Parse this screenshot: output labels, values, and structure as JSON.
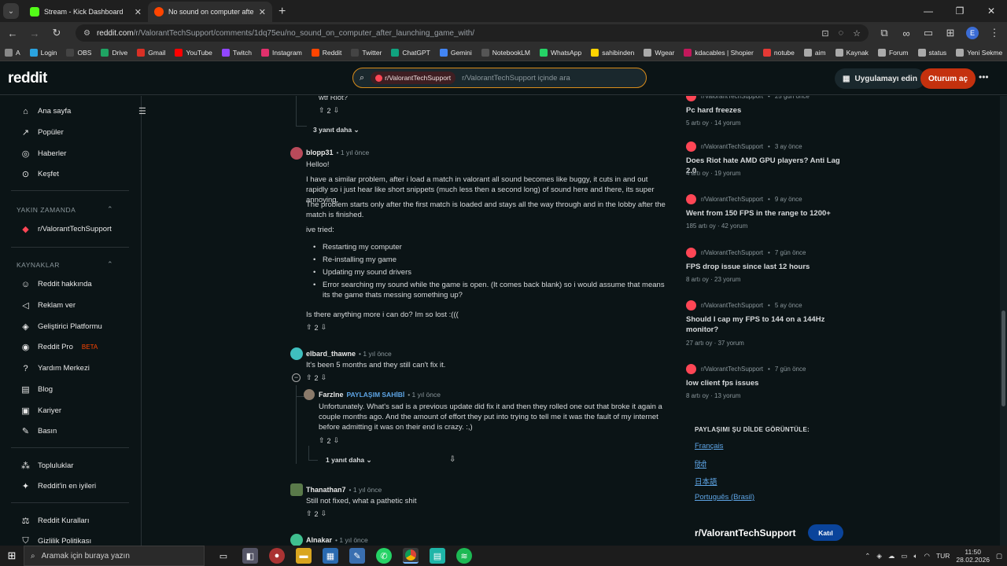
{
  "browser": {
    "tabs": [
      {
        "title": "Stream - Kick Dashboard",
        "active": false,
        "color": "#53fc18"
      },
      {
        "title": "No sound on computer after la",
        "active": true,
        "color": "#ff4500"
      }
    ],
    "url_host": "reddit.com",
    "url_path": "/r/ValorantTechSupport/comments/1dq75eu/no_sound_on_computer_after_launching_game_with/",
    "profile_initial": "E",
    "bookmarks": [
      "A",
      "Login",
      "OBS",
      "Drive",
      "Gmail",
      "YouTube",
      "Twitch",
      "Instagram",
      "Reddit",
      "Twitter",
      "ChatGPT",
      "Gemini",
      "NotebookLM",
      "WhatsApp",
      "sahibinden",
      "Wgear",
      "kdacables | Shopier",
      "notube",
      "aim",
      "Kaynak",
      "Forum",
      "status",
      "Yeni Sekme"
    ]
  },
  "header": {
    "logo": "reddit",
    "search_chip": "r/ValorantTechSupport",
    "search_placeholder": "r/ValorantTechSupport içinde ara",
    "app_button": "Uygulamayı edin",
    "login_button": "Oturum aç"
  },
  "left_nav": {
    "main": [
      "Ana sayfa",
      "Popüler",
      "Haberler",
      "Keşfet"
    ],
    "recent_label": "YAKIN ZAMANDA",
    "recent": [
      "r/ValorantTechSupport"
    ],
    "resources_label": "KAYNAKLAR",
    "resources": [
      "Reddit hakkında",
      "Reklam ver",
      "Geliştirici Platformu",
      "Reddit Pro",
      "Yardım Merkezi",
      "Blog",
      "Kariyer",
      "Basın"
    ],
    "beta": "BETA",
    "extra": [
      "Topluluklar",
      "Reddit'in en iyileri"
    ],
    "policies": [
      "Reddit Kuralları",
      "Gizlilik Politikası"
    ]
  },
  "comments": {
    "top_text": "wtf Riot?",
    "top_votes": "2",
    "top_more": "3 yanıt daha",
    "c1": {
      "user": "blopp31",
      "time": "1 yıl önce",
      "p1": "Helloo!",
      "p2": "I have a similar problem, after i load a match in valorant all sound becomes like buggy, it cuts in and out rapidly so i just hear like short snippets (much less then a second long) of sound here and there, its super annoying.",
      "p3": "The problem starts only after the first match is loaded and stays all the way through and in the lobby after the match is finished.",
      "p4": "ive tried:",
      "bullets": [
        "Restarting my computer",
        "Re-installing my game",
        "Updating my sound drivers",
        "Error searching my sound while the game is open. (It comes back blank) so i would assume that means its the game thats messing something up?"
      ],
      "p5": "Is there anything more i can do? Im so lost :(((",
      "votes": "2"
    },
    "c2": {
      "user": "elbard_thawne",
      "time": "1 yıl önce",
      "text": "It's been 5 months and they still can't fix it.",
      "votes": "2"
    },
    "c3": {
      "user": "Farzlne",
      "op": "PAYLAŞIM SAHİBİ",
      "time": "1 yıl önce",
      "text": "Unfortunately. What's sad is a previous update did fix it and then they rolled one out that broke it again a couple months ago. And the amount of effort they put into trying to tell me it was the fault of my internet before admitting it was on their end is crazy. :,)",
      "votes": "2",
      "more": "1 yanıt daha"
    },
    "c4": {
      "user": "Thanathan7",
      "time": "1 yıl önce",
      "text": "Still not fixed, what a pathetic shit",
      "votes": "2"
    },
    "c5": {
      "user": "Alnakar",
      "time": "1 yıl önce"
    }
  },
  "right_sidebar": {
    "posts": [
      {
        "sub": "r/ValorantTechSupport",
        "time": "25 gün önce",
        "title": "Pc hard freezes",
        "votes": "5 artı oy",
        "comments": "14 yorum"
      },
      {
        "sub": "r/ValorantTechSupport",
        "time": "3 ay önce",
        "title": "Does Riot hate AMD GPU players? Anti Lag 2.0",
        "votes": "4 artı oy",
        "comments": "19 yorum"
      },
      {
        "sub": "r/ValorantTechSupport",
        "time": "9 ay önce",
        "title": "Went from 150 FPS in the range to 1200+",
        "votes": "185 artı oy",
        "comments": "42 yorum"
      },
      {
        "sub": "r/ValorantTechSupport",
        "time": "7 gün önce",
        "title": "FPS drop issue since last 12 hours",
        "votes": "8 artı oy",
        "comments": "23 yorum"
      },
      {
        "sub": "r/ValorantTechSupport",
        "time": "5 ay önce",
        "title": "Should I cap my FPS to 144 on a 144Hz monitor?",
        "votes": "27 artı oy",
        "comments": "37 yorum"
      },
      {
        "sub": "r/ValorantTechSupport",
        "time": "7 gün önce",
        "title": "low client fps issues",
        "votes": "8 artı oy",
        "comments": "13 yorum"
      }
    ],
    "lang_label": "PAYLAŞIMI ŞU DİLDE GÖRÜNTÜLE:",
    "languages": [
      "Français",
      "हिंदी",
      "日本語",
      "Português (Brasil)"
    ],
    "sub_name": "r/ValorantTechSupport",
    "join": "Katıl"
  },
  "taskbar": {
    "search_placeholder": "Aramak için buraya yazın",
    "lang": "TUR",
    "time": "11:50",
    "date": "28.02.2026"
  },
  "colors": {
    "accent": "#ff4500",
    "link": "#5ea5e6",
    "valorant": "#ff4655"
  }
}
